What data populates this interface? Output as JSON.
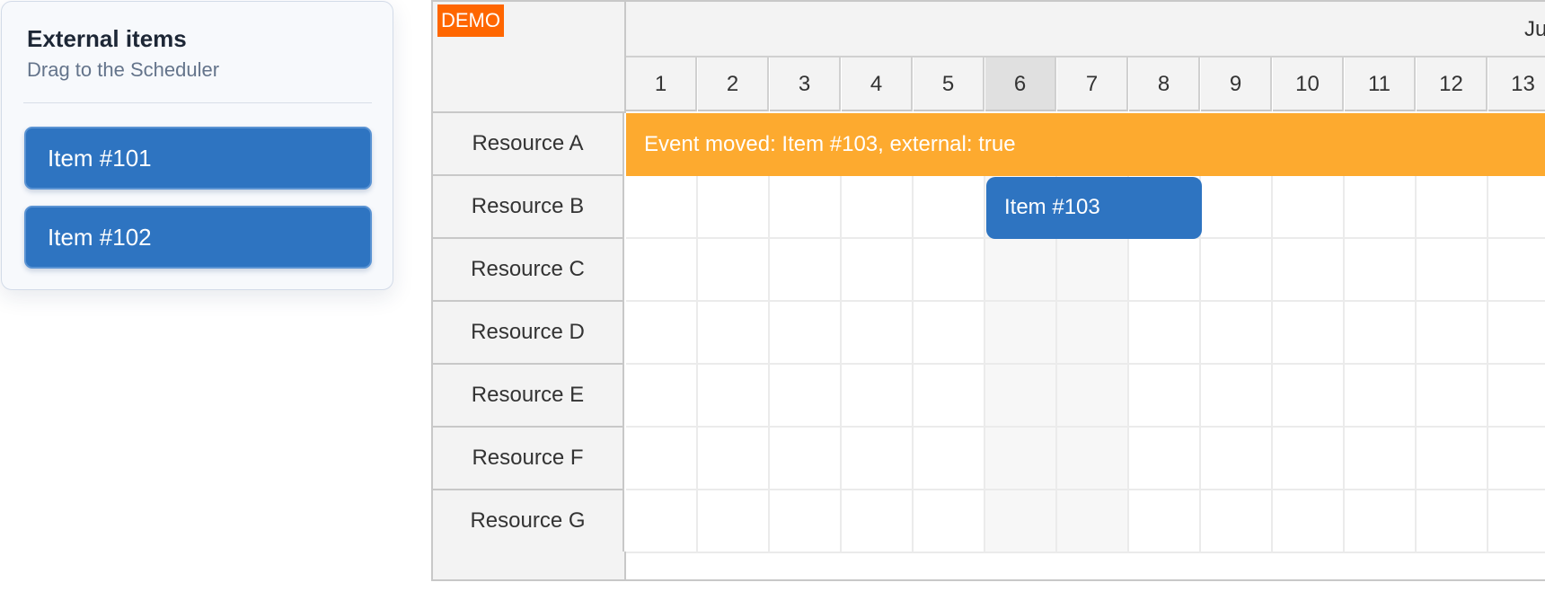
{
  "external_panel": {
    "title": "External items",
    "subtitle": "Drag to the Scheduler",
    "items": [
      {
        "label": "Item #101"
      },
      {
        "label": "Item #102"
      }
    ]
  },
  "scheduler": {
    "demo_badge": "DEMO",
    "month_label": "Jun",
    "days": [
      "1",
      "2",
      "3",
      "4",
      "5",
      "6",
      "7",
      "8",
      "9",
      "10",
      "11",
      "12",
      "13"
    ],
    "highlighted_day": "6",
    "resources": [
      "Resource A",
      "Resource B",
      "Resource C",
      "Resource D",
      "Resource E",
      "Resource F",
      "Resource G"
    ],
    "message_bar": "Event moved: Item #103, external: true",
    "event": {
      "label": "Item #103"
    },
    "colors": {
      "event": "#2e74c1",
      "message_bar": "#fdaa2f",
      "demo_badge": "#ff6600",
      "highlighted_day": "#e0e0e0"
    }
  }
}
